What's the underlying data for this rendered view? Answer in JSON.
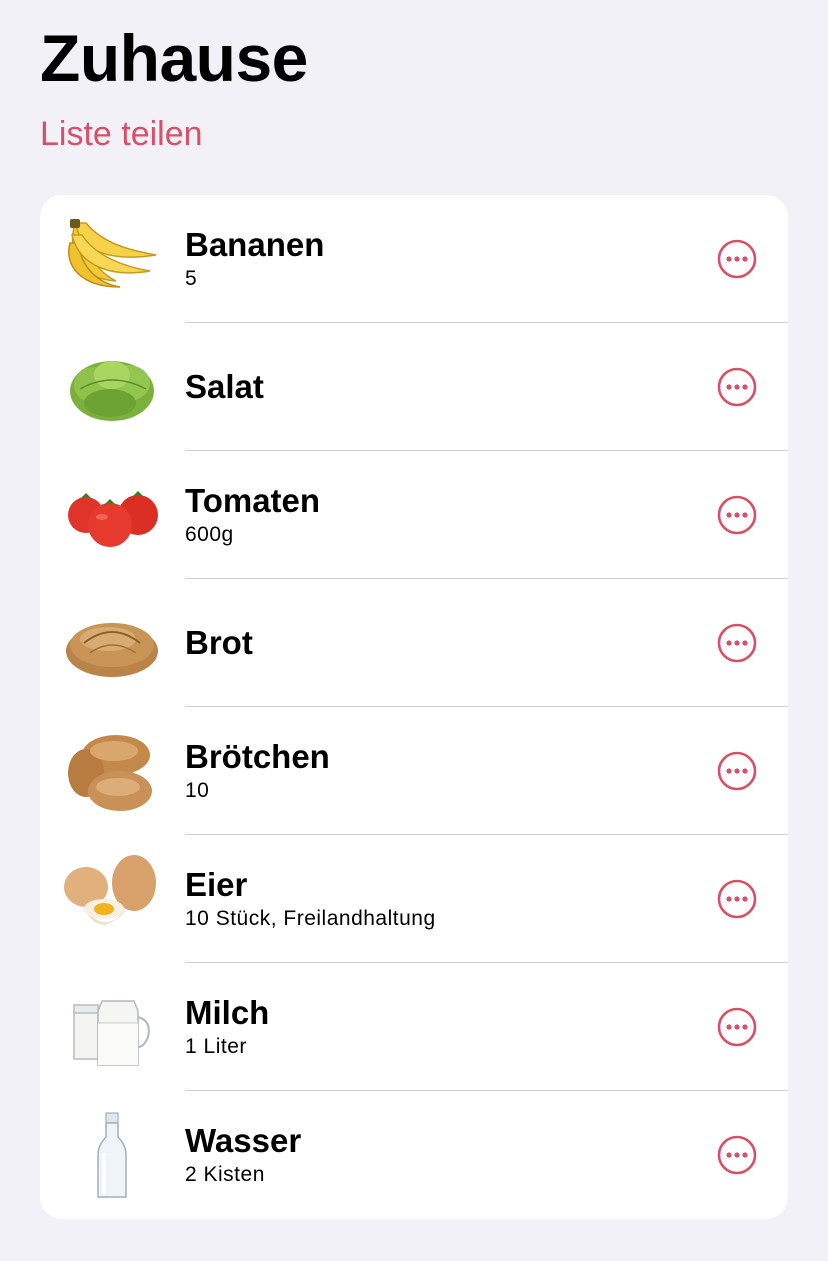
{
  "header": {
    "title": "Zuhause",
    "share_label": "Liste teilen"
  },
  "colors": {
    "accent": "#d94f68",
    "background": "#f2f1f7",
    "card": "#ffffff"
  },
  "items": [
    {
      "name": "Bananen",
      "detail": "5",
      "image": "banana-image"
    },
    {
      "name": "Salat",
      "detail": "",
      "image": "lettuce-image"
    },
    {
      "name": "Tomaten",
      "detail": "600g",
      "image": "tomato-image"
    },
    {
      "name": "Brot",
      "detail": "",
      "image": "bread-image"
    },
    {
      "name": "Brötchen",
      "detail": "10",
      "image": "bread-rolls-image"
    },
    {
      "name": "Eier",
      "detail": "10 Stück, Freilandhaltung",
      "image": "eggs-image"
    },
    {
      "name": "Milch",
      "detail": "1 Liter",
      "image": "milk-image"
    },
    {
      "name": "Wasser",
      "detail": "2 Kisten",
      "image": "water-bottle-image"
    }
  ],
  "more_icon": "ellipsis-circle-icon"
}
